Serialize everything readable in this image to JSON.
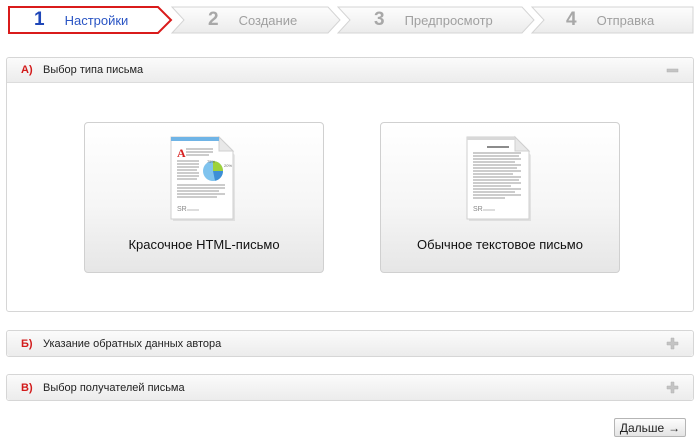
{
  "wizard": {
    "steps": [
      {
        "number": "1",
        "label": "Настройки"
      },
      {
        "number": "2",
        "label": "Создание"
      },
      {
        "number": "3",
        "label": "Предпросмотр"
      },
      {
        "number": "4",
        "label": "Отправка"
      }
    ],
    "active_color": "#d91b1b"
  },
  "panels": {
    "a": {
      "letter": "А)",
      "title": "Выбор типа письма",
      "state": "expanded"
    },
    "b": {
      "letter": "Б)",
      "title": "Указание обратных данных автора",
      "state": "collapsed"
    },
    "c": {
      "letter": "В)",
      "title": "Выбор получателей письма",
      "state": "collapsed"
    }
  },
  "cards": {
    "html": {
      "label": "Красочное HTML-письмо",
      "icon": "html-document-icon"
    },
    "text": {
      "label": "Обычное текстовое письмо",
      "icon": "text-document-icon"
    }
  },
  "footer": {
    "next_label": "Дальше",
    "next_arrow": "→"
  }
}
